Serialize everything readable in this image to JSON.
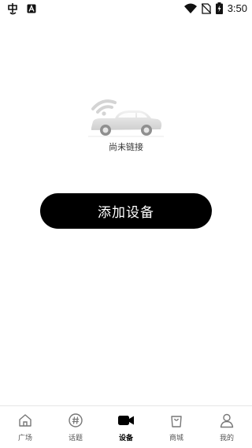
{
  "status_bar": {
    "time": "3:50",
    "left_icons": [
      "app-notification-icon",
      "a-notification-icon"
    ],
    "right_icons": [
      "wifi-icon",
      "no-sim-icon",
      "battery-charging-icon"
    ]
  },
  "empty_state": {
    "icon": "car-wireless-icon",
    "message": "尚未链接"
  },
  "actions": {
    "add_device_label": "添加设备"
  },
  "tab_bar": {
    "items": [
      {
        "label": "广场",
        "icon": "home-icon",
        "active": false
      },
      {
        "label": "话题",
        "icon": "hashtag-icon",
        "active": false
      },
      {
        "label": "设备",
        "icon": "video-camera-icon",
        "active": true
      },
      {
        "label": "商城",
        "icon": "shopping-bag-icon",
        "active": false
      },
      {
        "label": "我的",
        "icon": "profile-icon",
        "active": false
      }
    ]
  }
}
